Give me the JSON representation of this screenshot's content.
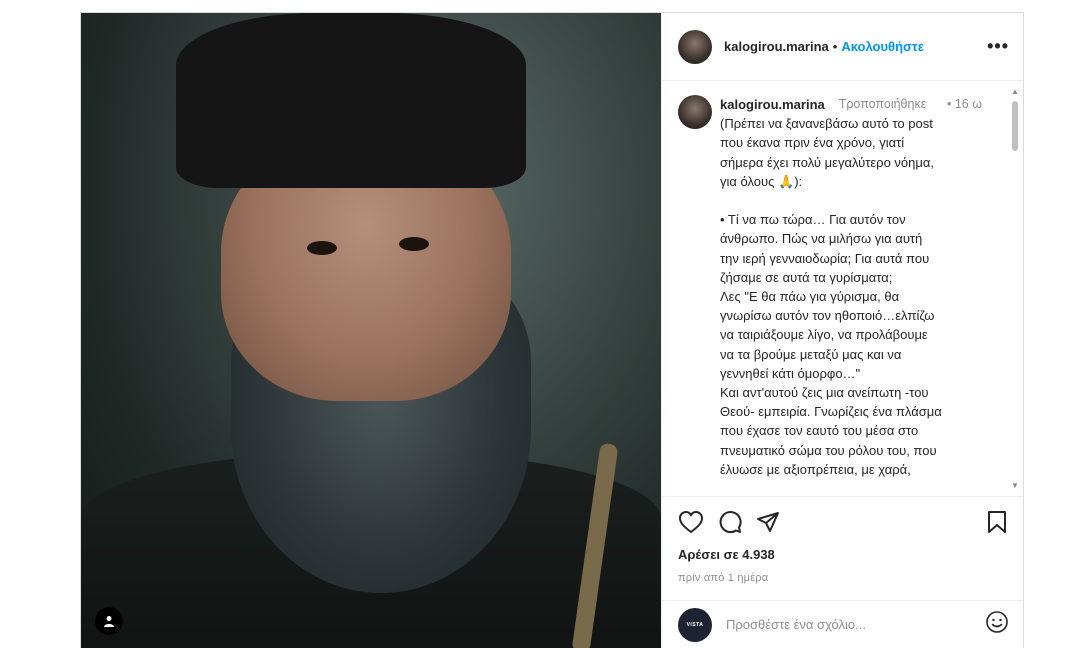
{
  "post": {
    "author": "kalogirou.marina",
    "separator": "•",
    "follow_label": "Ακολουθήστε",
    "more_label": "•••"
  },
  "caption": {
    "username": "kalogirou.marina",
    "edited": "Τροποποιήθηκε",
    "separator": "•",
    "time": "16 ω",
    "text": "(Πρέπει να ξανανεβάσω αυτό το post\nπου έκανα πριν ένα χρόνο, γιατί\nσήμερα έχει πολύ μεγαλύτερο νόημα,\nγια όλους 🙏):\n\n• Τί να πω τώρα… Για αυτόν τον\nάνθρωπο. Πώς να μιλήσω για αυτή\nτην ιερή γενναιοδωρία; Για αυτά που\nζήσαμε σε αυτά τα γυρίσματα;\nΛες \"Ε θα πάω για γύρισμα, θα\nγνωρίσω αυτόν τον ηθοποιό…ελπίζω\nνα ταιριάξουμε λίγο, να προλάβουμε\nνα τα βρούμε μεταξύ μας και να\nγεννηθεί κάτι όμορφο…\"\nΚαι αντ'αυτού ζεις μια ανείπωτη -του\nΘεού- εμπειρία. Γνωρίζεις ένα πλάσμα\nπου έχασε τον εαυτό του μέσα στο\nπνευματικό σώμα του ρόλου του, που\nέλυωσε με αξιοπρέπεια, με χαρά,"
  },
  "actions": {
    "likes": "Αρέσει σε 4.938",
    "time_ago": "πριν από 1 ημέρα"
  },
  "comment_box": {
    "placeholder": "Προσθέστε ένα σχόλιο...",
    "avatar_text": "VISTA"
  },
  "icons": {
    "like": "heart-icon",
    "comment": "comment-icon",
    "share": "paper-plane-icon",
    "save": "bookmark-icon",
    "emoji": "smiley-icon",
    "tag": "user-icon"
  },
  "colors": {
    "link_blue": "#0095f6",
    "muted": "#8e8e8e",
    "text": "#262626",
    "border": "#dbdbdb"
  }
}
